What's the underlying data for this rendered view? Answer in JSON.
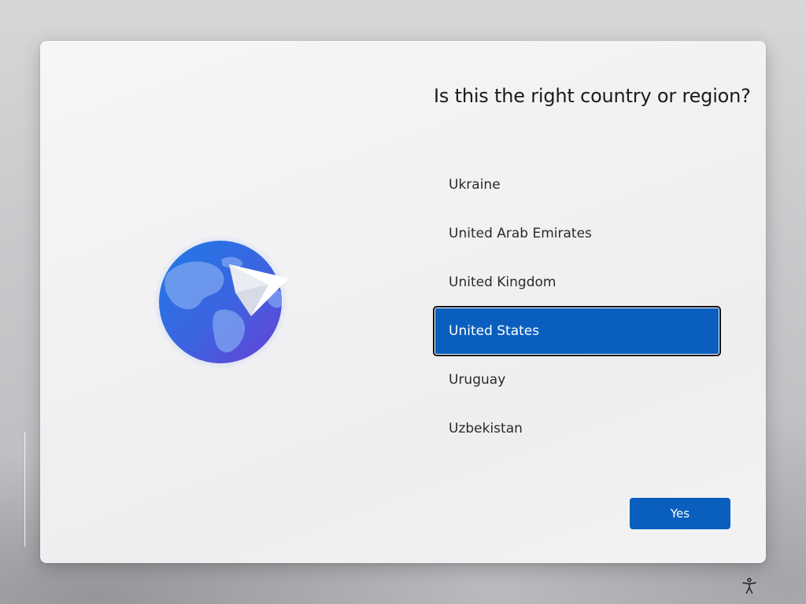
{
  "title": "Is this the right country or region?",
  "countries": [
    {
      "label": "Ukraine",
      "selected": false
    },
    {
      "label": "United Arab Emirates",
      "selected": false
    },
    {
      "label": "United Kingdom",
      "selected": false
    },
    {
      "label": "United States",
      "selected": true
    },
    {
      "label": "Uruguay",
      "selected": false
    },
    {
      "label": "Uzbekistan",
      "selected": false
    }
  ],
  "yes_button": "Yes",
  "icons": {
    "hero": "globe-paper-plane-icon",
    "accessibility": "accessibility-icon"
  },
  "colors": {
    "accent": "#0a5fbe",
    "selected_text": "#ffffff",
    "text": "#1b1b1b"
  }
}
